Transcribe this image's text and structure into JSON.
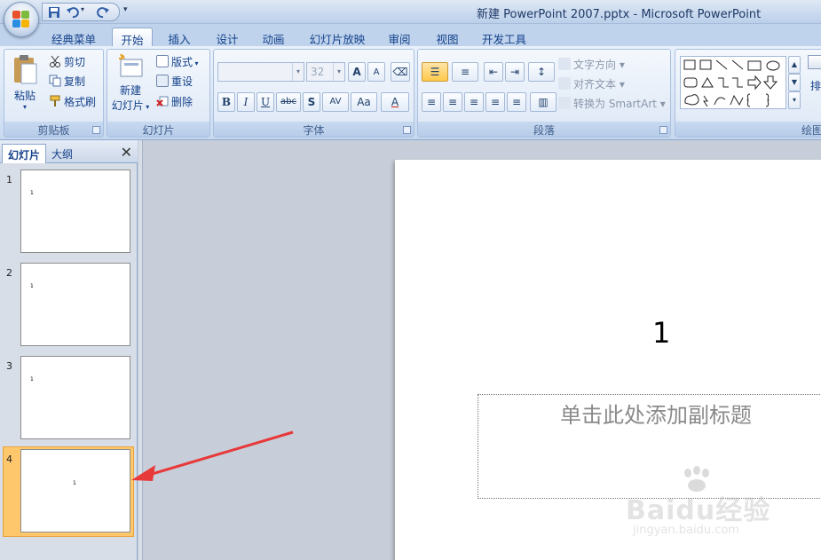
{
  "title_bar": {
    "title": "新建 PowerPoint 2007.pptx - Microsoft PowerPoint"
  },
  "tabs": [
    "经典菜单",
    "开始",
    "插入",
    "设计",
    "动画",
    "幻灯片放映",
    "审阅",
    "视图",
    "开发工具"
  ],
  "active_tab": "开始",
  "ribbon": {
    "clipboard": {
      "paste": "粘贴",
      "cut": "剪切",
      "copy": "复制",
      "format_painter": "格式刷",
      "label": "剪贴板"
    },
    "slides": {
      "new_slide_1": "新建",
      "new_slide_2": "幻灯片",
      "layout": "版式",
      "reset": "重设",
      "delete": "删除",
      "label": "幻灯片"
    },
    "font": {
      "font_size": "32",
      "label": "字体",
      "bold": "B",
      "italic": "I",
      "underline": "U",
      "strike": "abc",
      "shadow": "S",
      "spacing": "AV",
      "case": "Aa",
      "color": "A",
      "grow": "A",
      "shrink": "A"
    },
    "paragraph": {
      "text_direction": "文字方向",
      "align_text": "对齐文本",
      "convert_smartart": "转换为 SmartArt",
      "label": "段落"
    },
    "drawing": {
      "label": "绘图",
      "arrange": "排"
    }
  },
  "left_pane": {
    "tab_slides": "幻灯片",
    "tab_outline": "大纲",
    "thumbs": [
      {
        "num": "1",
        "mark": "1"
      },
      {
        "num": "2",
        "mark": "1"
      },
      {
        "num": "3",
        "mark": "1"
      },
      {
        "num": "4",
        "mark": "1"
      }
    ],
    "selected_index": 4
  },
  "slide": {
    "title": "1",
    "subtitle_placeholder": "单击此处添加副标题"
  },
  "watermark": {
    "logo": "Baidu经验",
    "url": "jingyan.baidu.com"
  },
  "colors": {
    "annotation_arrow": "#e8393a",
    "selected_thumb": "#ffc76b"
  }
}
